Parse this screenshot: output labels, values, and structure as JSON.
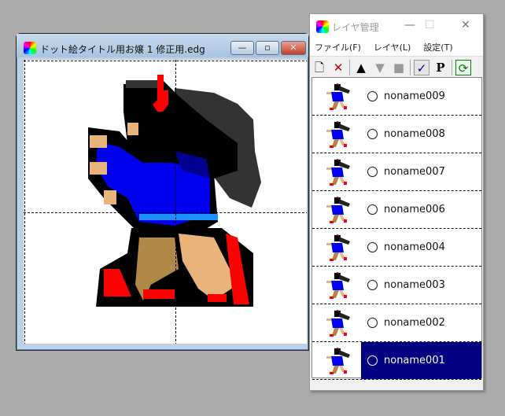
{
  "editor": {
    "title": "ドット絵タイトル用お嬢 1 修正用.edg",
    "minimize": "—",
    "maximize": "▫",
    "close": "✕"
  },
  "layer_window": {
    "title": "レイヤ管理",
    "minimize": "—",
    "maximize": "☐",
    "close": "✕",
    "menu": [
      "ファイル(F)",
      "レイヤ(L)",
      "設定(T)"
    ],
    "toolbar": {
      "new": "🗋",
      "delete": "✕",
      "up": "▲",
      "down": "▼",
      "stop": "■",
      "check": "✓",
      "p": "P",
      "refresh": "⟳"
    },
    "layers": [
      {
        "name": "noname009",
        "selected": false
      },
      {
        "name": "noname008",
        "selected": false
      },
      {
        "name": "noname007",
        "selected": false
      },
      {
        "name": "noname006",
        "selected": false
      },
      {
        "name": "noname004",
        "selected": false
      },
      {
        "name": "noname003",
        "selected": false
      },
      {
        "name": "noname002",
        "selected": false
      },
      {
        "name": "noname001",
        "selected": true
      }
    ]
  },
  "colors": {
    "selection": "#000080",
    "hair": "#333333",
    "blue": "#0000ee",
    "light_blue": "#1e90ff",
    "skin": "#e8b47c",
    "brown": "#b08848",
    "red": "#ff0000"
  }
}
